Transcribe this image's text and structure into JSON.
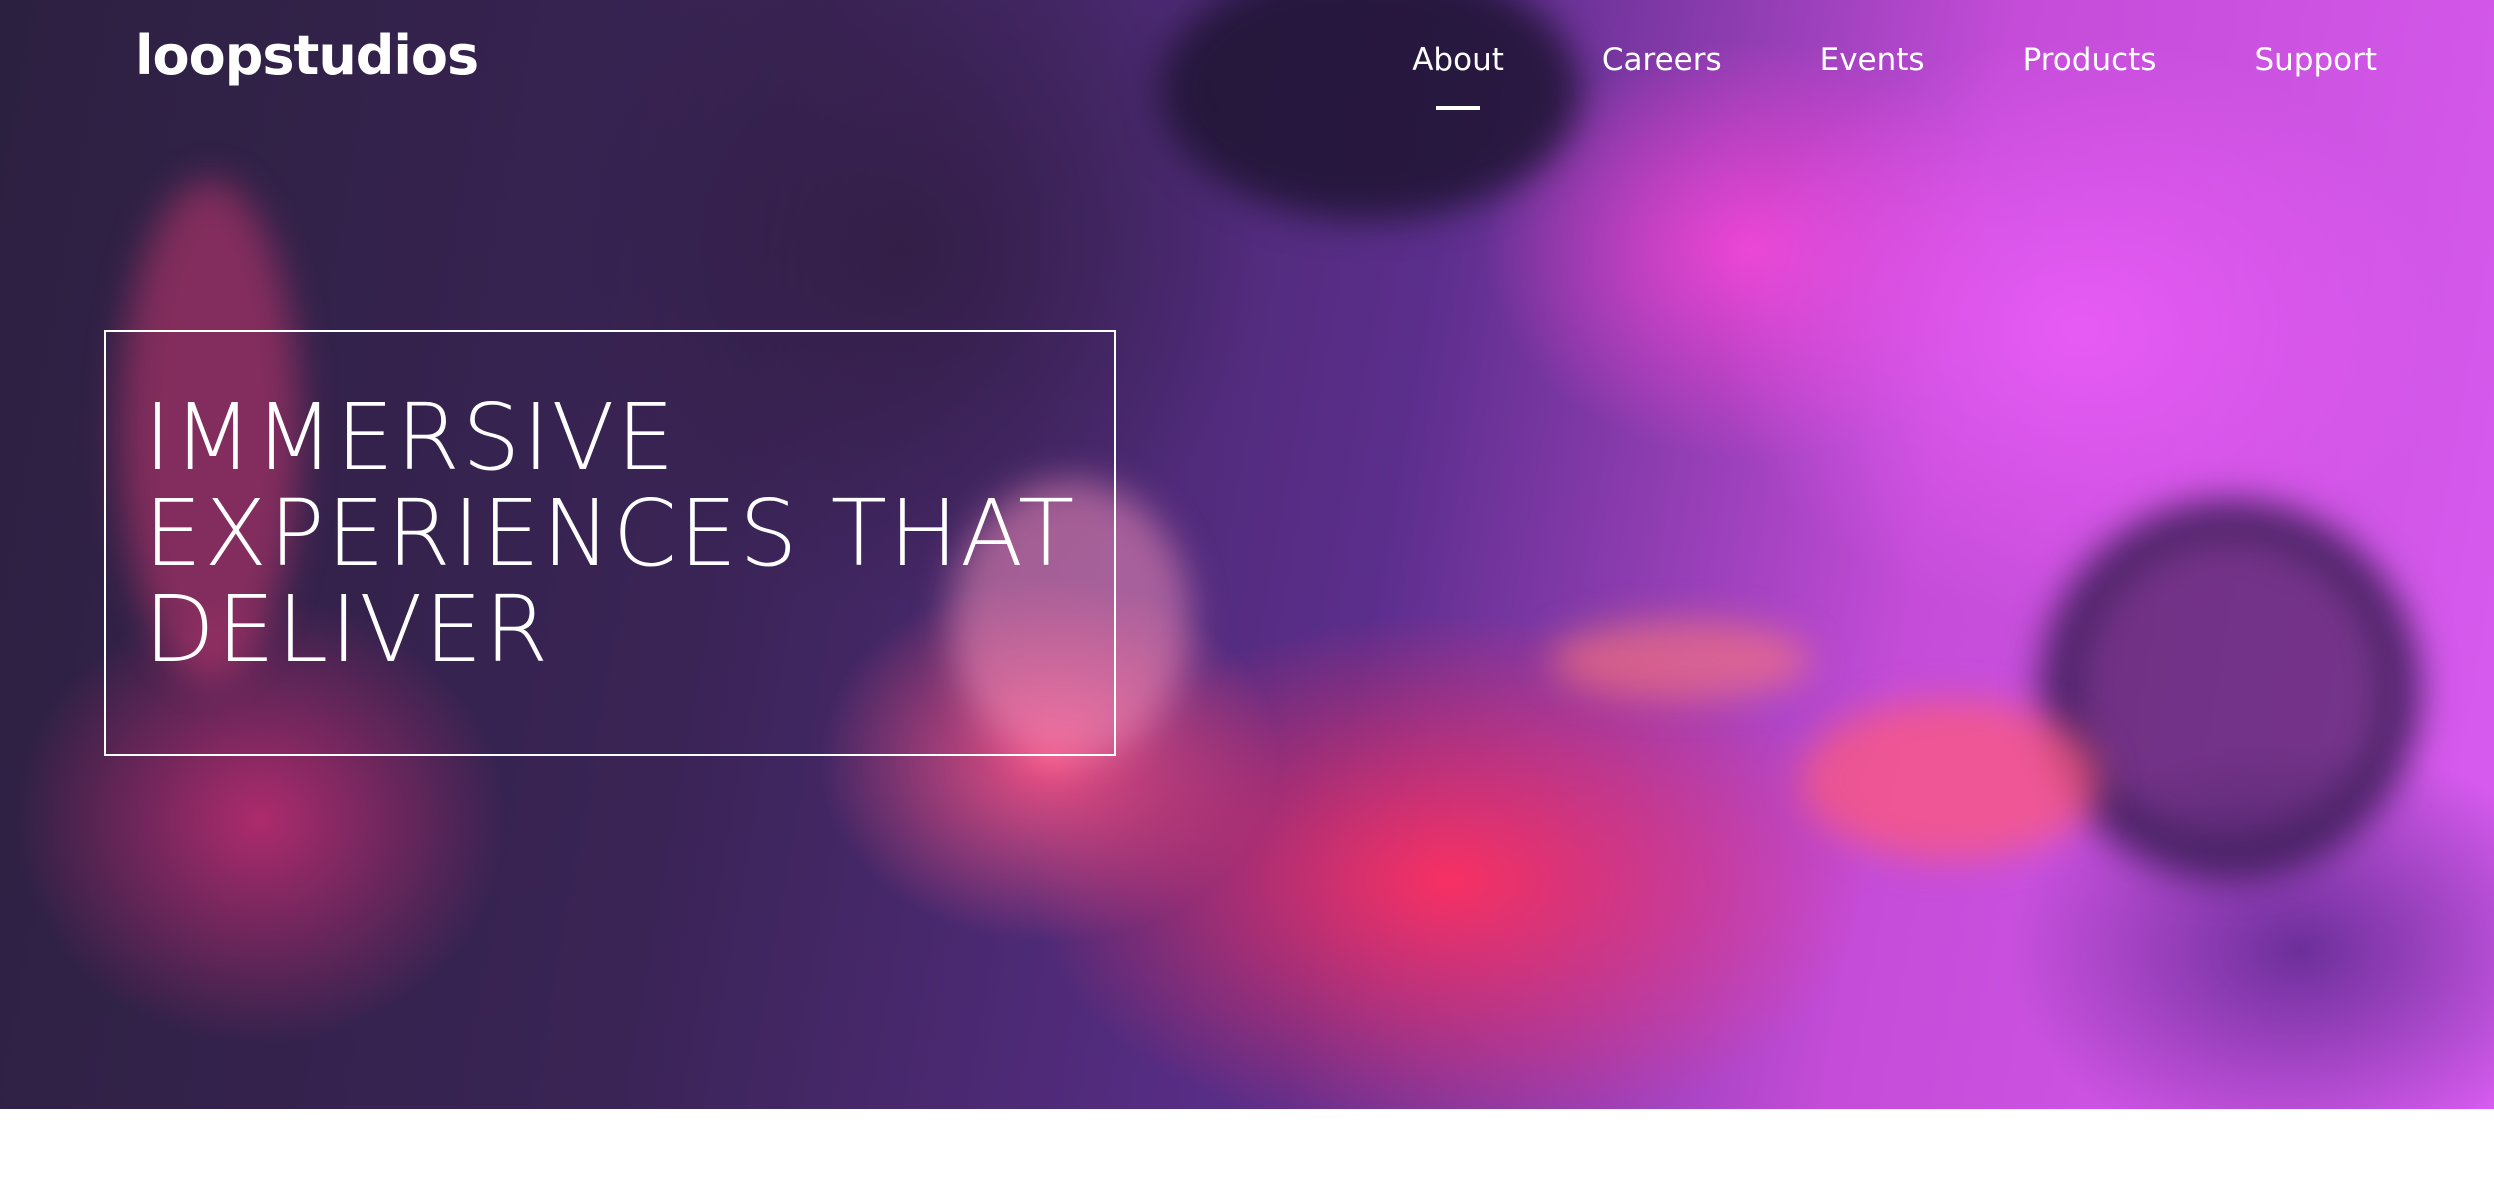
{
  "header": {
    "logo": "loopstudios",
    "nav": [
      {
        "label": "About",
        "active": true
      },
      {
        "label": "Careers",
        "active": false
      },
      {
        "label": "Events",
        "active": false
      },
      {
        "label": "Products",
        "active": false
      },
      {
        "label": "Support",
        "active": false
      }
    ]
  },
  "hero": {
    "headline_lines": [
      "IMMERSIVE",
      "EXPERIENCES THAT",
      "DELIVER"
    ]
  },
  "colors": {
    "text": "#ffffff",
    "hero_magenta": "#d85cf0",
    "hero_red": "#ff3060",
    "hero_dark": "#2c2040"
  }
}
